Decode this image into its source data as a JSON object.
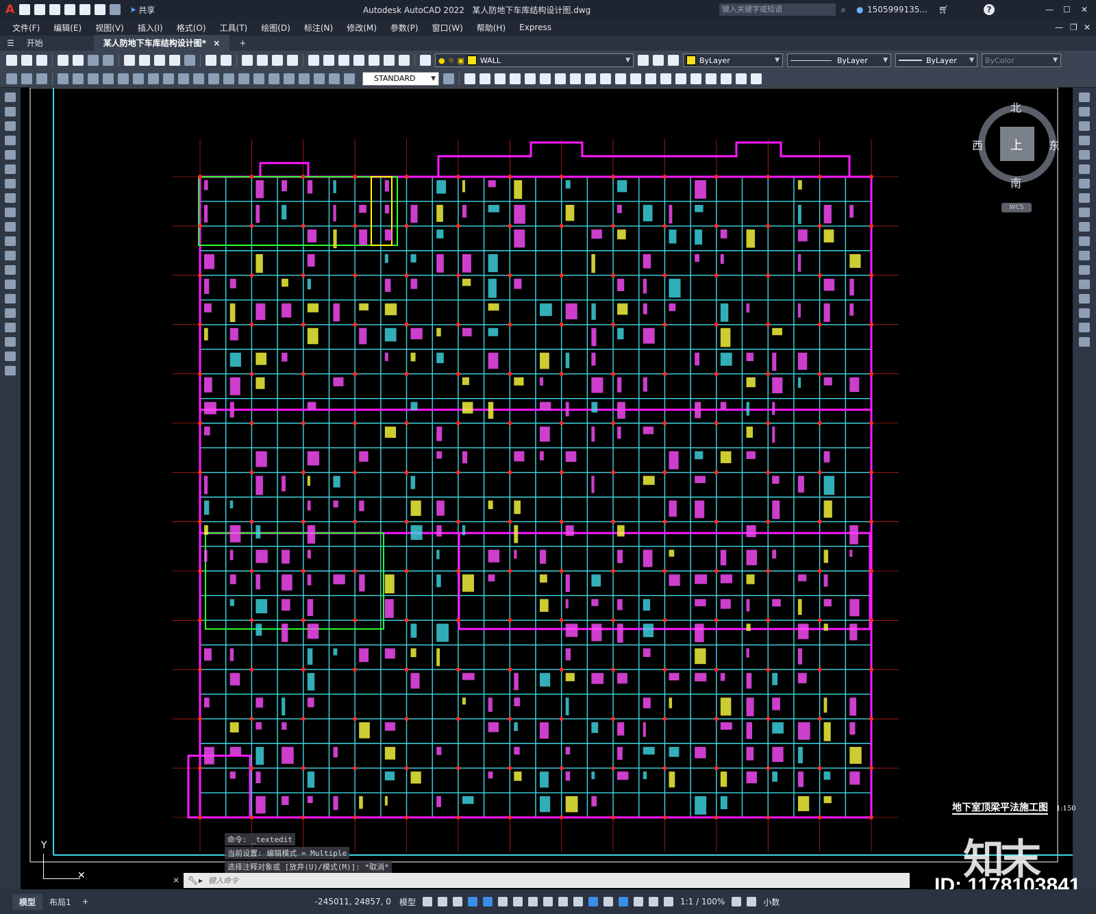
{
  "app": {
    "title": "Autodesk AutoCAD 2022",
    "file": "某人防地下车库结构设计图.dwg",
    "share": "共享",
    "search_placeholder": "键入关键字或短语",
    "user": "1505999135...",
    "help": "?"
  },
  "menu": [
    "文件(F)",
    "编辑(E)",
    "视图(V)",
    "插入(I)",
    "格式(O)",
    "工具(T)",
    "绘图(D)",
    "标注(N)",
    "修改(M)",
    "参数(P)",
    "窗口(W)",
    "帮助(H)",
    "Express"
  ],
  "tabs": {
    "start": "开始",
    "active": "某人防地下车库结构设计图*",
    "close": "×",
    "add": "+"
  },
  "toolbar": {
    "layer": "WALL",
    "color": "ByLayer",
    "linetype": "ByLayer",
    "lineweight": "ByLayer",
    "plotstyle": "ByColor",
    "textstyle": "STANDARD",
    "layer_color": "#f5e21a"
  },
  "viewcube": {
    "north": "北",
    "south": "南",
    "east": "东",
    "west": "西",
    "top": "上",
    "ucs": "WCS"
  },
  "ucs_icon": {
    "y": "Y"
  },
  "drawing": {
    "title": "地下室顶梁平法施工图",
    "scale": "1:150",
    "colors": {
      "wall": "#ff1aff",
      "beam": "#3fd9e6",
      "axis": "#ff2a2a",
      "green": "#2bff2b",
      "yellow": "#ffff00"
    }
  },
  "command": {
    "history": [
      "命令: _textedit",
      "当前设置: 编辑模式 = Multiple",
      "选择注释对象或 [放弃(U)/模式(M)]: *取消*"
    ],
    "placeholder": "键入命令"
  },
  "status": {
    "model_tab": "模型",
    "layout_tab": "布局1",
    "coords": "-245011, 24857, 0",
    "model": "模型",
    "scale": "1:1 / 100%",
    "units": "小数"
  },
  "watermark": {
    "logo": "知末",
    "id": "ID: 1178103841"
  }
}
